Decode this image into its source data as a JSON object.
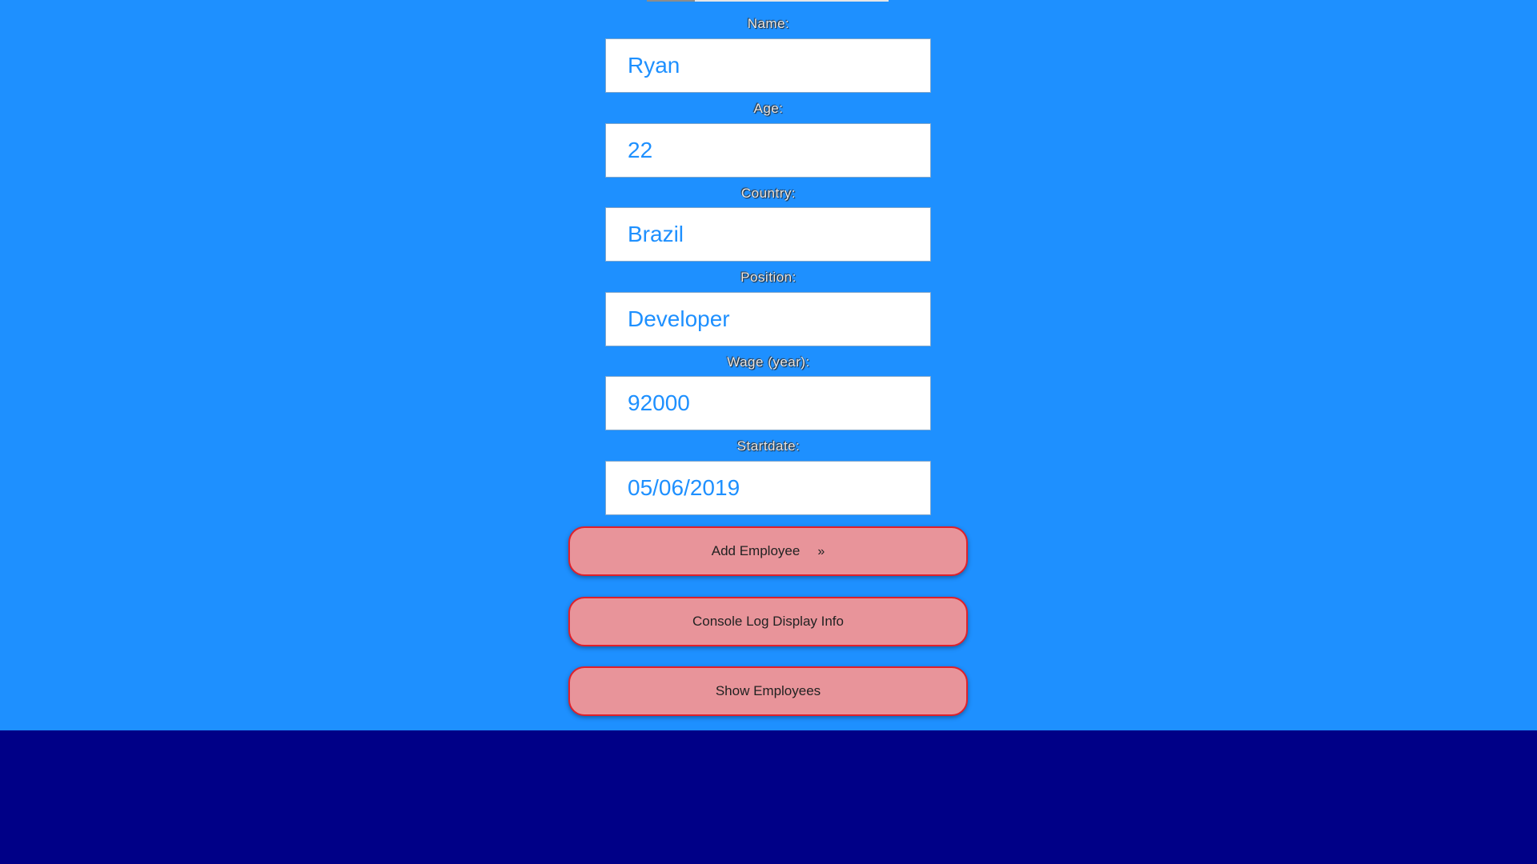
{
  "form": {
    "fields": [
      {
        "label": "Name:",
        "value": "Ryan"
      },
      {
        "label": "Age:",
        "value": "22"
      },
      {
        "label": "Country:",
        "value": "Brazil"
      },
      {
        "label": "Position:",
        "value": "Developer"
      },
      {
        "label": "Wage (year):",
        "value": "92000"
      },
      {
        "label": "Startdate:",
        "value": "05/06/2019"
      }
    ]
  },
  "buttons": {
    "add_employee": "Add Employee",
    "add_employee_icon": "»",
    "console_log": "Console Log Display Info",
    "show_employees": "Show Employees"
  },
  "colors": {
    "background_top": "#1e90ff",
    "background_bottom": "#000087",
    "input_text": "#1e90ff",
    "button_fill": "#e8949a",
    "button_border": "#e0202a"
  }
}
